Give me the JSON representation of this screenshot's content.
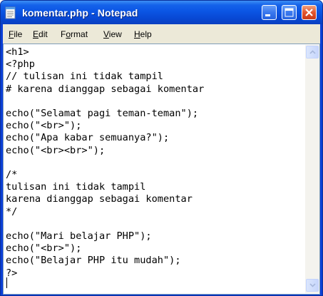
{
  "window": {
    "title": "komentar.php - Notepad"
  },
  "titlebar_buttons": [
    "minimize-icon",
    "maximize-icon",
    "close-icon"
  ],
  "menu": {
    "items": [
      {
        "underline": "F",
        "rest": "ile"
      },
      {
        "underline": "E",
        "rest": "dit"
      },
      {
        "underline": "",
        "rest": "Format",
        "prefix": "F",
        "after": "o",
        "tail": "rmat"
      },
      {
        "underline": "V",
        "rest": "iew"
      },
      {
        "underline": "H",
        "rest": "elp"
      }
    ]
  },
  "editor": {
    "content": "<h1>\n<?php\n// tulisan ini tidak tampil\n# karena dianggap sebagai komentar\n\necho(\"Selamat pagi teman-teman\");\necho(\"<br>\");\necho(\"Apa kabar semuanya?\");\necho(\"<br><br>\");\n\n/*\ntulisan ini tidak tampil\nkarena dianggap sebagai komentar\n*/\n\necho(\"Mari belajar PHP\");\necho(\"<br>\");\necho(\"Belajar PHP itu mudah\");\n?>"
  },
  "colors": {
    "titlebar": "#0b55e4",
    "menubar": "#ece9d8",
    "close_button": "#e2552f"
  }
}
